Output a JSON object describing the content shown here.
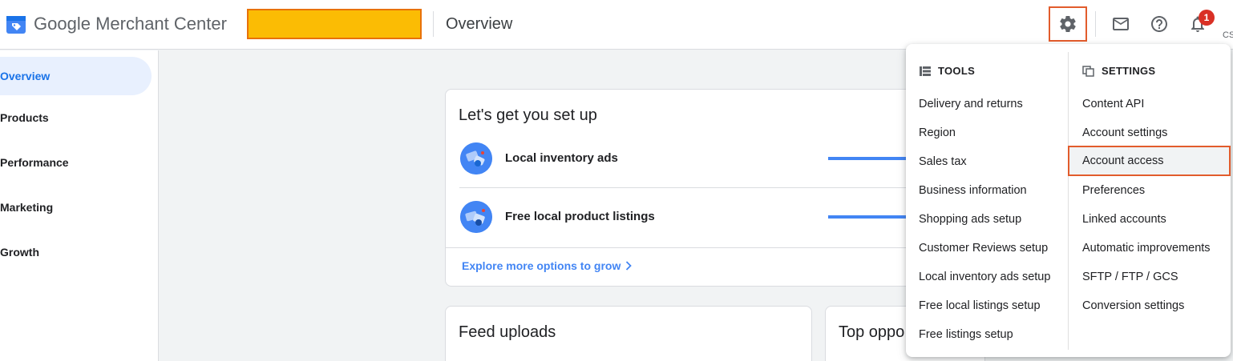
{
  "header": {
    "brand_google": "Google",
    "brand_product": "Merchant Center",
    "page_title": "Overview",
    "notification_count": "1",
    "user_initials": "CS"
  },
  "sidebar": {
    "items": [
      {
        "label": "Overview",
        "active": true
      },
      {
        "label": "Products",
        "active": false
      },
      {
        "label": "Performance",
        "active": false
      },
      {
        "label": "Marketing",
        "active": false
      },
      {
        "label": "Growth",
        "active": false
      }
    ]
  },
  "setup_card": {
    "title": "Let's get you set up",
    "rows": [
      {
        "label": "Local inventory ads"
      },
      {
        "label": "Free local product listings"
      }
    ],
    "explore_link": "Explore more options to grow"
  },
  "feed_card": {
    "title": "Feed uploads"
  },
  "top_card": {
    "title": "Top oppo"
  },
  "menu": {
    "tools": {
      "heading": "TOOLS",
      "items": [
        "Delivery and returns",
        "Region",
        "Sales tax",
        "Business information",
        "Shopping ads setup",
        "Customer Reviews setup",
        "Local inventory ads setup",
        "Free local listings setup",
        "Free listings setup"
      ]
    },
    "settings": {
      "heading": "SETTINGS",
      "items": [
        "Content API",
        "Account settings",
        "Account access",
        "Preferences",
        "Linked accounts",
        "Automatic improvements",
        "SFTP / FTP / GCS",
        "Conversion settings"
      ]
    }
  },
  "colors": {
    "accent": "#1a73e8",
    "highlight_outline": "#e25c2c",
    "account_block": "#fbbc04"
  }
}
